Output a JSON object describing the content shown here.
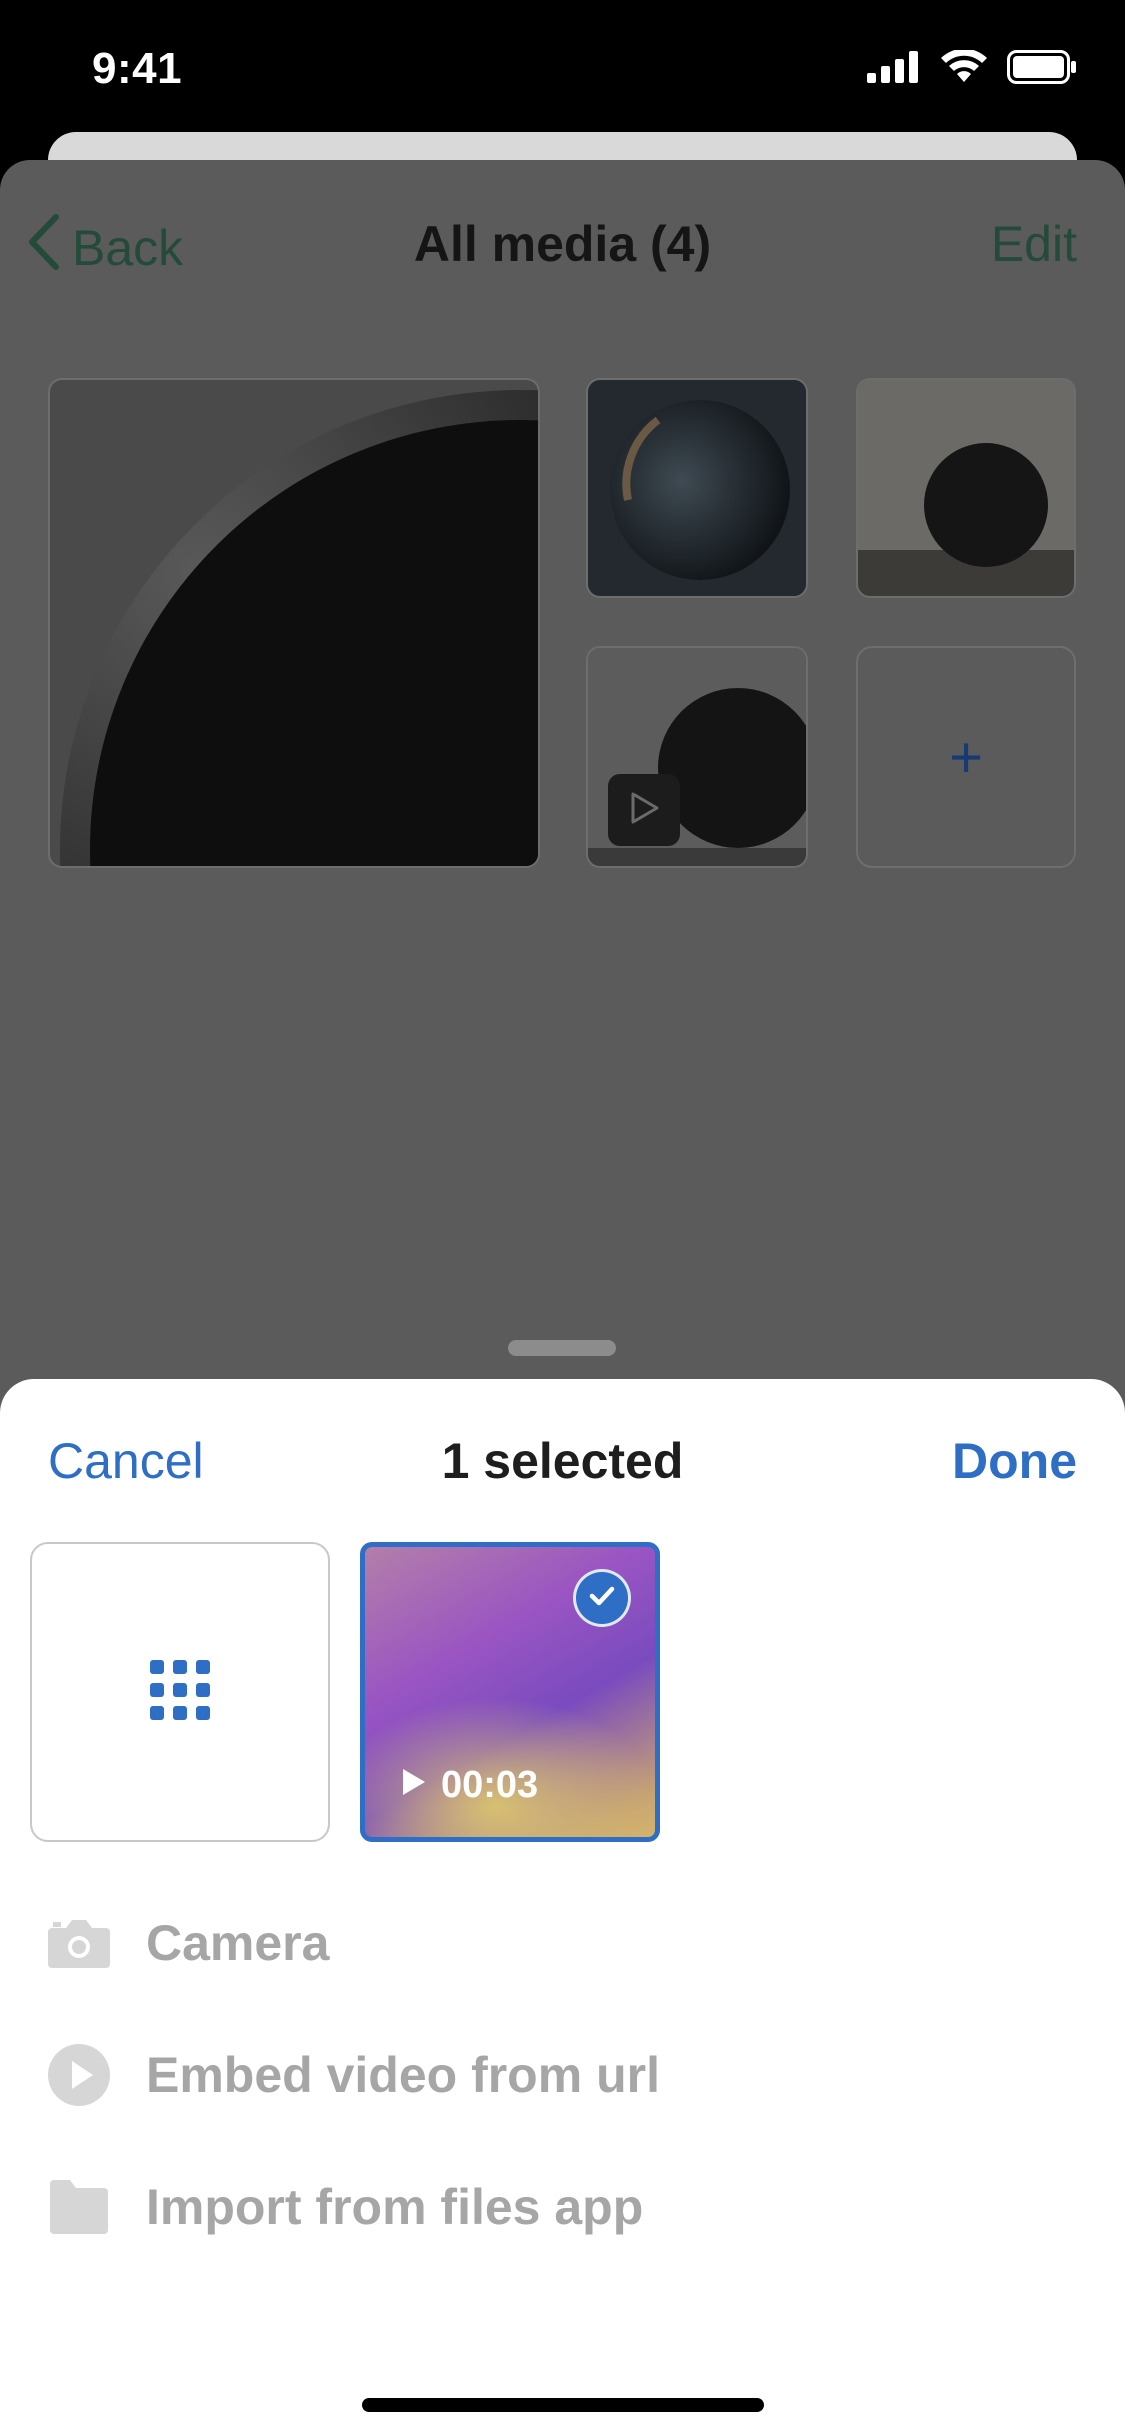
{
  "status_bar": {
    "time": "9:41",
    "icons": [
      "cellular-signal-icon",
      "wifi-icon",
      "battery-icon"
    ]
  },
  "background_screen": {
    "nav": {
      "back_label": "Back",
      "title": "All media (4)",
      "edit_label": "Edit"
    },
    "media_items": [
      "image",
      "image",
      "image",
      "video"
    ],
    "add_label": "+"
  },
  "picker": {
    "cancel_label": "Cancel",
    "title": "1 selected",
    "done_label": "Done",
    "selected_video": {
      "duration": "00:03",
      "selected": true
    },
    "actions": [
      {
        "label": "Camera",
        "icon": "camera-icon"
      },
      {
        "label": "Embed video from url",
        "icon": "play-circle-icon"
      },
      {
        "label": "Import from files app",
        "icon": "folder-icon"
      }
    ]
  },
  "colors": {
    "accent": "#2e6ec4",
    "dim_overlay": "#5b5b5b",
    "nav_text_dimmed": "#244a3a",
    "disabled_text": "#a6a6a6"
  }
}
